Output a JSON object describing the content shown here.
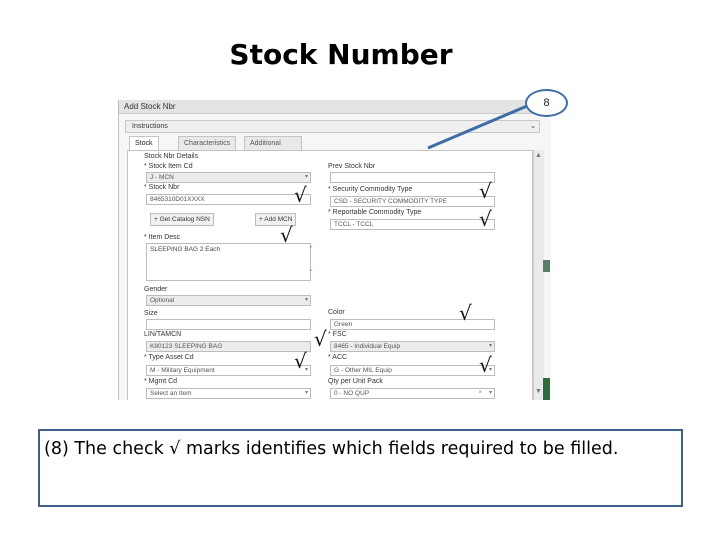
{
  "slide": {
    "title": "Stock Number",
    "callout_number": "8",
    "caption": "(8) The check √ marks  identifies which fields required to be filled."
  },
  "window": {
    "title": "Add Stock Nbr",
    "instructions_label": "Instructions",
    "tabs": [
      "Stock Nbr",
      "Characteristics",
      "Additional Characteristics"
    ],
    "section_label": "Stock Nbr Details"
  },
  "form": {
    "stock_item_cd": {
      "label": "* Stock Item Cd",
      "value": "J - MCN"
    },
    "stock_nbr": {
      "label": "* Stock Nbr",
      "value": "8465310D01XXXX"
    },
    "get_catalog_button": "Get Catalog NSN",
    "add_mcn_button": "Add MCN",
    "item_desc": {
      "label": "* Item Desc",
      "value": "SLEEPING BAG 2 Each"
    },
    "gender": {
      "label": "Gender",
      "value": "Optional"
    },
    "size": {
      "label": "Size",
      "value": ""
    },
    "lin_tamcn": {
      "label": "LIN/TAMCN",
      "value": "K80123   SLEEPING BAG"
    },
    "type_asset_cd": {
      "label": "* Type Asset Cd",
      "value": "M - Military Equipment"
    },
    "mgmt_cd": {
      "label": "* Mgmt Cd",
      "value": "Select an Item"
    },
    "prev_stock_nbr": {
      "label": "Prev Stock Nbr",
      "value": ""
    },
    "security_commodity_type": {
      "label": "* Security Commodity Type",
      "value": "CSD - SECURITY COMMODITY TYPE"
    },
    "reportable_commodity_type": {
      "label": "* Reportable Commodity Type",
      "value": "TCCL - TCCL"
    },
    "color": {
      "label": "Color",
      "value": "Green"
    },
    "fsc": {
      "label": "* FSC",
      "value": "8465 - Individual Equip"
    },
    "acc": {
      "label": "* ACC",
      "value": "G - Other MIL Equip"
    },
    "qty_per_unit_pack": {
      "label": "Qty per Unit Pack",
      "value": "0 - NO QUP"
    }
  },
  "check_mark": "√",
  "icons": {
    "dropdown": "▾",
    "clear": "×",
    "plus": "+",
    "scroll_up": "▲",
    "scroll_down": "▼",
    "collapse": "⌃",
    "expand": "⌄"
  },
  "colors": {
    "callout_border": "#3f6ea5",
    "caption_border": "#3f5f86",
    "arrow": "#3f6ea5"
  }
}
